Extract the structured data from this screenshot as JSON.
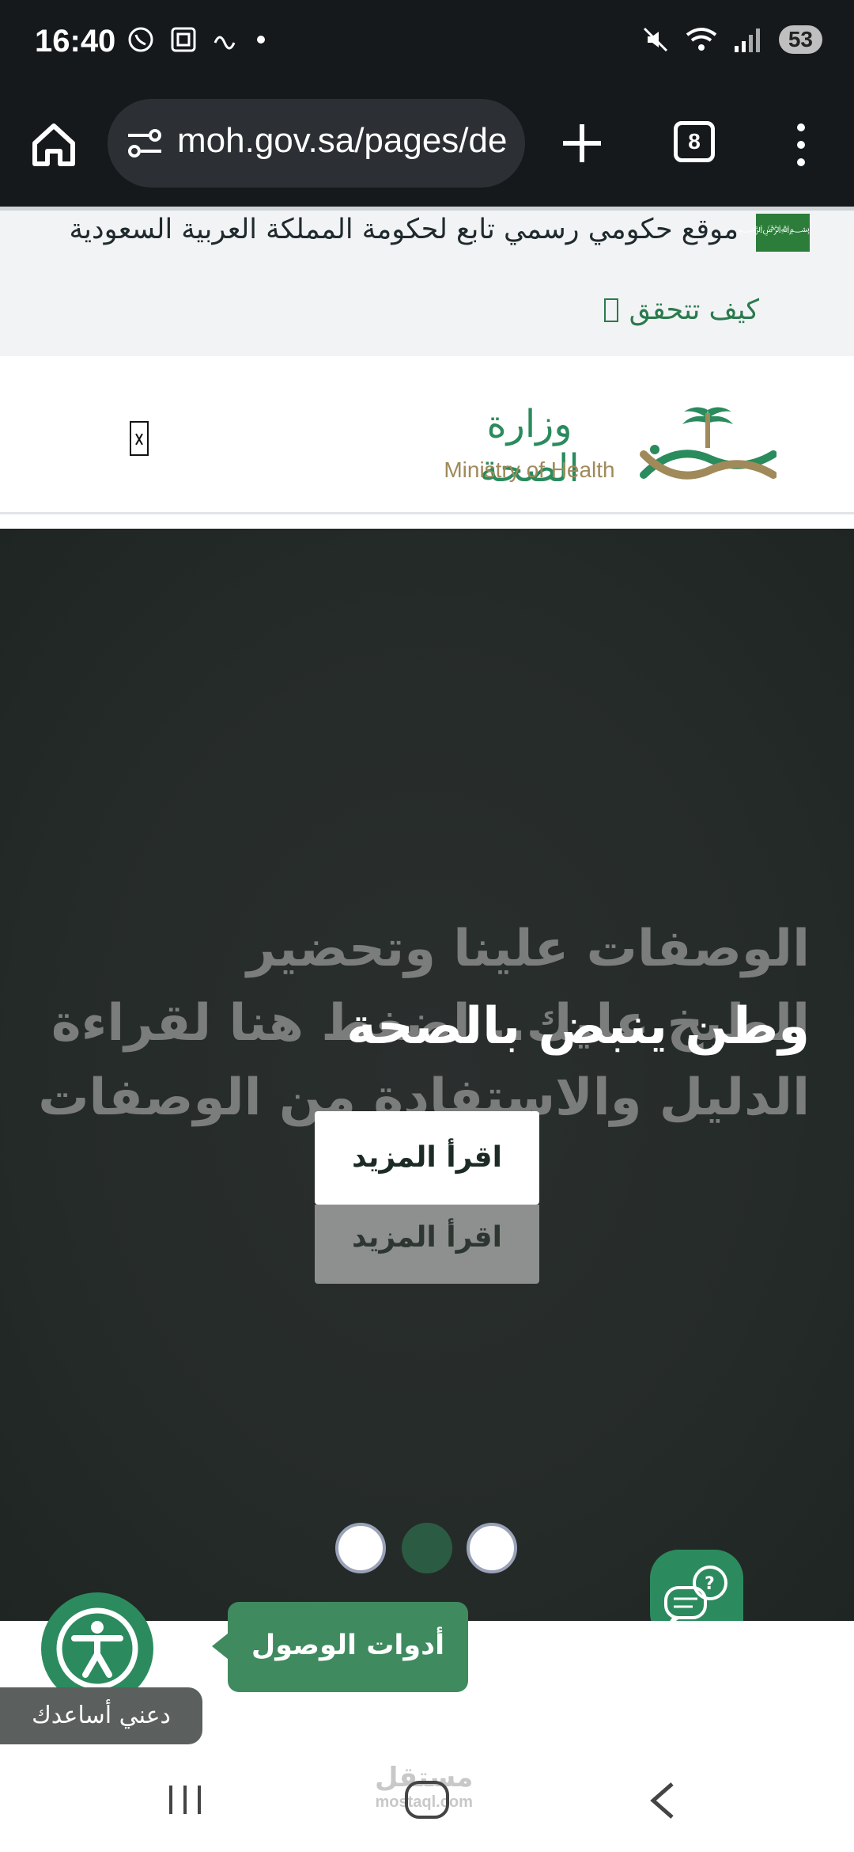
{
  "status_bar": {
    "time": "16:40",
    "battery": "53",
    "left_icons": [
      "whatsapp-icon",
      "screenshot-icon",
      "link-icon",
      "dot-icon"
    ],
    "right_icons": [
      "mute-icon",
      "wifi-icon",
      "signal-icon"
    ]
  },
  "browser": {
    "url": "moh.gov.sa/pages/de",
    "tab_count": "8"
  },
  "gov_banner": {
    "text": "موقع حكومي رسمي تابع لحكومة المملكة العربية السعودية",
    "verify_label": "كيف تتحقق"
  },
  "header": {
    "logo_ar": "وزارة الصحة",
    "logo_en": "Ministry of Health"
  },
  "hero": {
    "ghost_lines": [
      "الوصفات علينا وتحضير",
      "الطبخ عليك.. اضغط هنا لقراءة",
      "الدليل والاستفادة من الوصفات"
    ],
    "title": "وطن ينبض بالصحة",
    "read_more": "اقرأ المزيد",
    "read_more_ghost": "اقرأ المزيد",
    "active_slide": 2,
    "slide_count": 3
  },
  "accessibility": {
    "tools_label": "أدوات الوصول",
    "help_label": "دعني أساعدك"
  },
  "watermark": {
    "ar": "مستقل",
    "en": "mostaql.com"
  },
  "colors": {
    "brand_green": "#2c8b5e",
    "dark_bg": "#16191c",
    "hero_bg": "#252b29"
  }
}
